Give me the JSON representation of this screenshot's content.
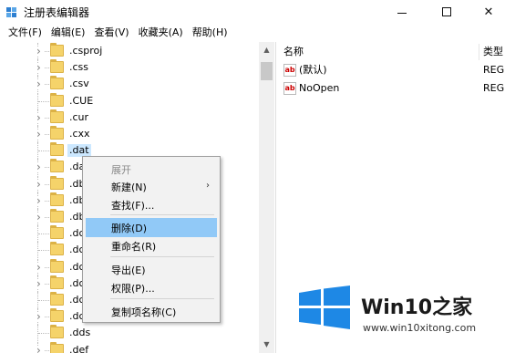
{
  "window": {
    "title": "注册表编辑器",
    "minimize_label": "—",
    "close_label": "✕"
  },
  "menu": [
    "文件(F)",
    "编辑(E)",
    "查看(V)",
    "收藏夹(A)",
    "帮助(H)"
  ],
  "tree": {
    "items": [
      {
        "label": ".csproj",
        "expandable": true
      },
      {
        "label": ".css",
        "expandable": true
      },
      {
        "label": ".csv",
        "expandable": true
      },
      {
        "label": ".CUE",
        "expandable": false
      },
      {
        "label": ".cur",
        "expandable": true
      },
      {
        "label": ".cxx",
        "expandable": true
      },
      {
        "label": ".dat",
        "expandable": false,
        "selected": true
      },
      {
        "label": ".da",
        "expandable": true
      },
      {
        "label": ".db",
        "expandable": true
      },
      {
        "label": ".db",
        "expandable": true
      },
      {
        "label": ".db",
        "expandable": true
      },
      {
        "label": ".dc",
        "expandable": false
      },
      {
        "label": ".dc",
        "expandable": false
      },
      {
        "label": ".dc",
        "expandable": true
      },
      {
        "label": ".dc",
        "expandable": true
      },
      {
        "label": ".dc",
        "expandable": false
      },
      {
        "label": ".dc",
        "expandable": true
      },
      {
        "label": ".dds",
        "expandable": false
      },
      {
        "label": ".def",
        "expandable": true
      }
    ]
  },
  "values_pane": {
    "columns": {
      "name": "名称",
      "type": "类型"
    },
    "rows": [
      {
        "name": "(默认)",
        "type": "REG",
        "icon": "ab-string-icon"
      },
      {
        "name": "NoOpen",
        "type": "REG",
        "icon": "ab-string-icon"
      }
    ]
  },
  "context_menu": {
    "items": [
      {
        "label": "展开",
        "disabled": true
      },
      {
        "label": "新建(N)",
        "submenu": true
      },
      {
        "label": "查找(F)..."
      },
      {
        "label": "删除(D)",
        "highlight": true
      },
      {
        "label": "重命名(R)"
      },
      {
        "label": "导出(E)"
      },
      {
        "label": "权限(P)..."
      },
      {
        "label": "复制项名称(C)"
      }
    ],
    "submenu_arrow": "›"
  },
  "watermark": {
    "title_prefix": "Win10",
    "title_suffix": "之家",
    "url": "www.win10xitong.com",
    "logo_color": "#1e88e5"
  },
  "colors": {
    "selection": "#cce8ff",
    "menu_highlight": "#91c9f7",
    "folder": "#f5d36a"
  }
}
